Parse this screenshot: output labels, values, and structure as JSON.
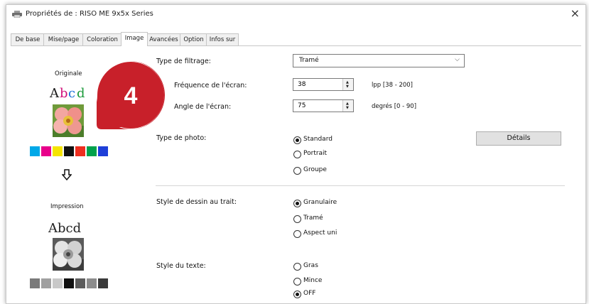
{
  "window": {
    "title": "Propriétés de : RISO ME 9x5x Series"
  },
  "tabs": [
    {
      "label": "De base"
    },
    {
      "label": "Mise/page"
    },
    {
      "label": "Coloration"
    },
    {
      "label": "Image"
    },
    {
      "label": "Avancées"
    },
    {
      "label": "Option"
    },
    {
      "label": "Infos sur"
    }
  ],
  "active_tab": "Image",
  "preview": {
    "original_label": "Originale",
    "original_sample_text": [
      "A",
      "b",
      "c",
      "d"
    ],
    "original_colors": [
      "#00a8e8",
      "#e8008a",
      "#f5e400",
      "#111111",
      "#ee2e1f",
      "#00a14b",
      "#1e3fd8"
    ],
    "print_label": "Impression",
    "print_sample_text": "Abcd",
    "print_grays": [
      "#7a7a7a",
      "#a0a0a0",
      "#c8c8c8",
      "#111111",
      "#5c5c5c",
      "#8c8c8c",
      "#3a3a3a"
    ],
    "arrow_icon": "down-arrow-icon"
  },
  "filter": {
    "label": "Type de filtrage:",
    "value": "Tramé"
  },
  "screen_freq": {
    "label": "Fréquence de l'écran:",
    "value": "38",
    "range": "lpp [38 - 200]"
  },
  "screen_angle": {
    "label": "Angle de l'écran:",
    "value": "75",
    "range": "degrés [0 - 90]"
  },
  "photo": {
    "label": "Type de photo:",
    "options": [
      "Standard",
      "Portrait",
      "Groupe"
    ],
    "selected": "Standard",
    "details_button": "Détails"
  },
  "line_style": {
    "label": "Style de dessin au trait:",
    "options": [
      "Granulaire",
      "Tramé",
      "Aspect uni"
    ],
    "selected": "Granulaire"
  },
  "text_style": {
    "label": "Style du texte:",
    "options": [
      "Gras",
      "Mince",
      "OFF"
    ],
    "selected": "OFF"
  },
  "callout": {
    "number": "4",
    "color": "#c8202a"
  }
}
